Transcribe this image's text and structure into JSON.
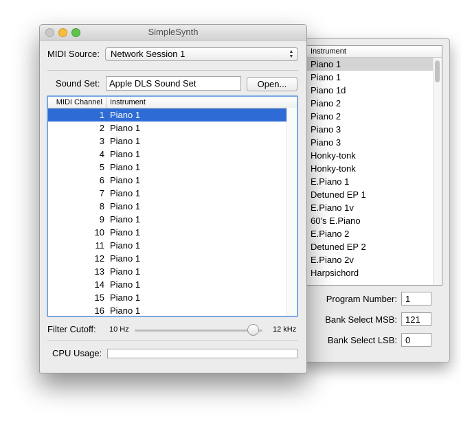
{
  "window": {
    "title": "SimpleSynth"
  },
  "midi_source": {
    "label": "MIDI Source:",
    "value": "Network Session 1"
  },
  "sound_set": {
    "label": "Sound Set:",
    "value": "Apple DLS Sound Set",
    "open_button": "Open..."
  },
  "channel_table": {
    "columns": [
      "MIDI Channel",
      "Instrument"
    ],
    "selected_index": 0,
    "rows": [
      {
        "channel": "1",
        "instrument": "Piano 1"
      },
      {
        "channel": "2",
        "instrument": "Piano 1"
      },
      {
        "channel": "3",
        "instrument": "Piano 1"
      },
      {
        "channel": "4",
        "instrument": "Piano 1"
      },
      {
        "channel": "5",
        "instrument": "Piano 1"
      },
      {
        "channel": "6",
        "instrument": "Piano 1"
      },
      {
        "channel": "7",
        "instrument": "Piano 1"
      },
      {
        "channel": "8",
        "instrument": "Piano 1"
      },
      {
        "channel": "9",
        "instrument": "Piano 1"
      },
      {
        "channel": "10",
        "instrument": "Piano 1"
      },
      {
        "channel": "11",
        "instrument": "Piano 1"
      },
      {
        "channel": "12",
        "instrument": "Piano 1"
      },
      {
        "channel": "13",
        "instrument": "Piano 1"
      },
      {
        "channel": "14",
        "instrument": "Piano 1"
      },
      {
        "channel": "15",
        "instrument": "Piano 1"
      },
      {
        "channel": "16",
        "instrument": "Piano 1"
      }
    ]
  },
  "filter_cutoff": {
    "label": "Filter Cutoff:",
    "min_label": "10 Hz",
    "max_label": "12 kHz",
    "level_fraction": 0.97
  },
  "cpu_usage": {
    "label": "CPU Usage:",
    "fraction": 0.0
  },
  "instrument_drawer": {
    "header": "Instrument",
    "selected_index": 0,
    "items": [
      "Piano 1",
      "Piano 1",
      "Piano 1d",
      "Piano 2",
      "Piano 2",
      "Piano 3",
      "Piano 3",
      "Honky-tonk",
      "Honky-tonk",
      "E.Piano 1",
      "Detuned EP 1",
      "E.Piano 1v",
      "60's E.Piano",
      "E.Piano 2",
      "Detuned EP 2",
      "E.Piano 2v",
      "Harpsichord"
    ],
    "program_number": {
      "label": "Program Number:",
      "value": "1"
    },
    "bank_msb": {
      "label": "Bank Select MSB:",
      "value": "121"
    },
    "bank_lsb": {
      "label": "Bank Select LSB:",
      "value": "0"
    }
  },
  "colors": {
    "selection": "#2e6bd4",
    "focus_ring": "#7aa7e3",
    "drawer_selection": "#d4d4d4"
  }
}
